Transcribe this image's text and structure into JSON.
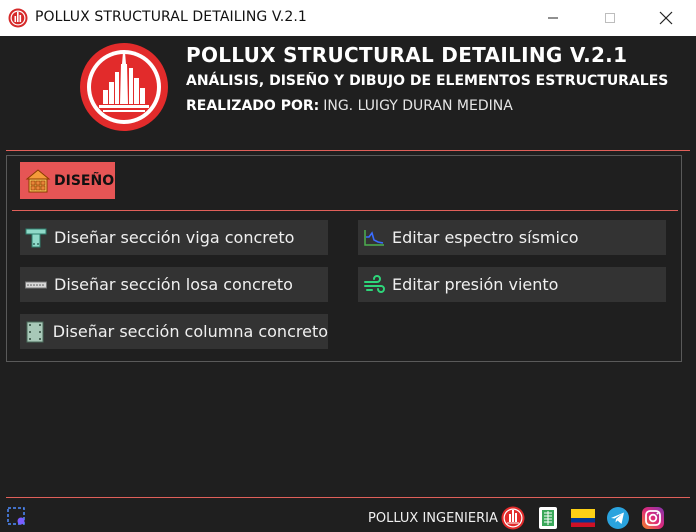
{
  "window": {
    "title": "POLLUX STRUCTURAL DETAILING V.2.1",
    "icons": {
      "minimize": "minimize-icon",
      "maximize": "maximize-icon",
      "close": "close-icon"
    }
  },
  "header": {
    "title": "POLLUX STRUCTURAL DETAILING V.2.1",
    "subtitle": "ANÁLISIS, DISEÑO Y DIBUJO DE ELEMENTOS ESTRUCTURALES",
    "author_label": "REALIZADO POR:",
    "author_name": "ING. LUIGY DURAN MEDINA"
  },
  "tab": {
    "label": "DISEÑO",
    "icon": "house-grid-icon"
  },
  "buttons": {
    "viga": {
      "label": "Diseñar sección viga concreto",
      "icon": "t-beam-icon"
    },
    "losa": {
      "label": "Diseñar sección losa concreto",
      "icon": "slab-icon"
    },
    "columna": {
      "label": "Diseñar sección columna concreto",
      "icon": "column-icon"
    },
    "espectro": {
      "label": "Editar espectro sísmico",
      "icon": "spectrum-icon"
    },
    "viento": {
      "label": "Editar presión viento",
      "icon": "wind-icon"
    }
  },
  "footer": {
    "label": "POLLUX INGENIERIA",
    "icons": [
      "pollux-logo-icon",
      "document-icon",
      "colombia-flag-icon",
      "telegram-icon",
      "instagram-icon"
    ]
  },
  "colors": {
    "accent": "#e65555",
    "background": "#1f1f1f",
    "button_bg": "#333333",
    "separator": "#e0605a"
  }
}
